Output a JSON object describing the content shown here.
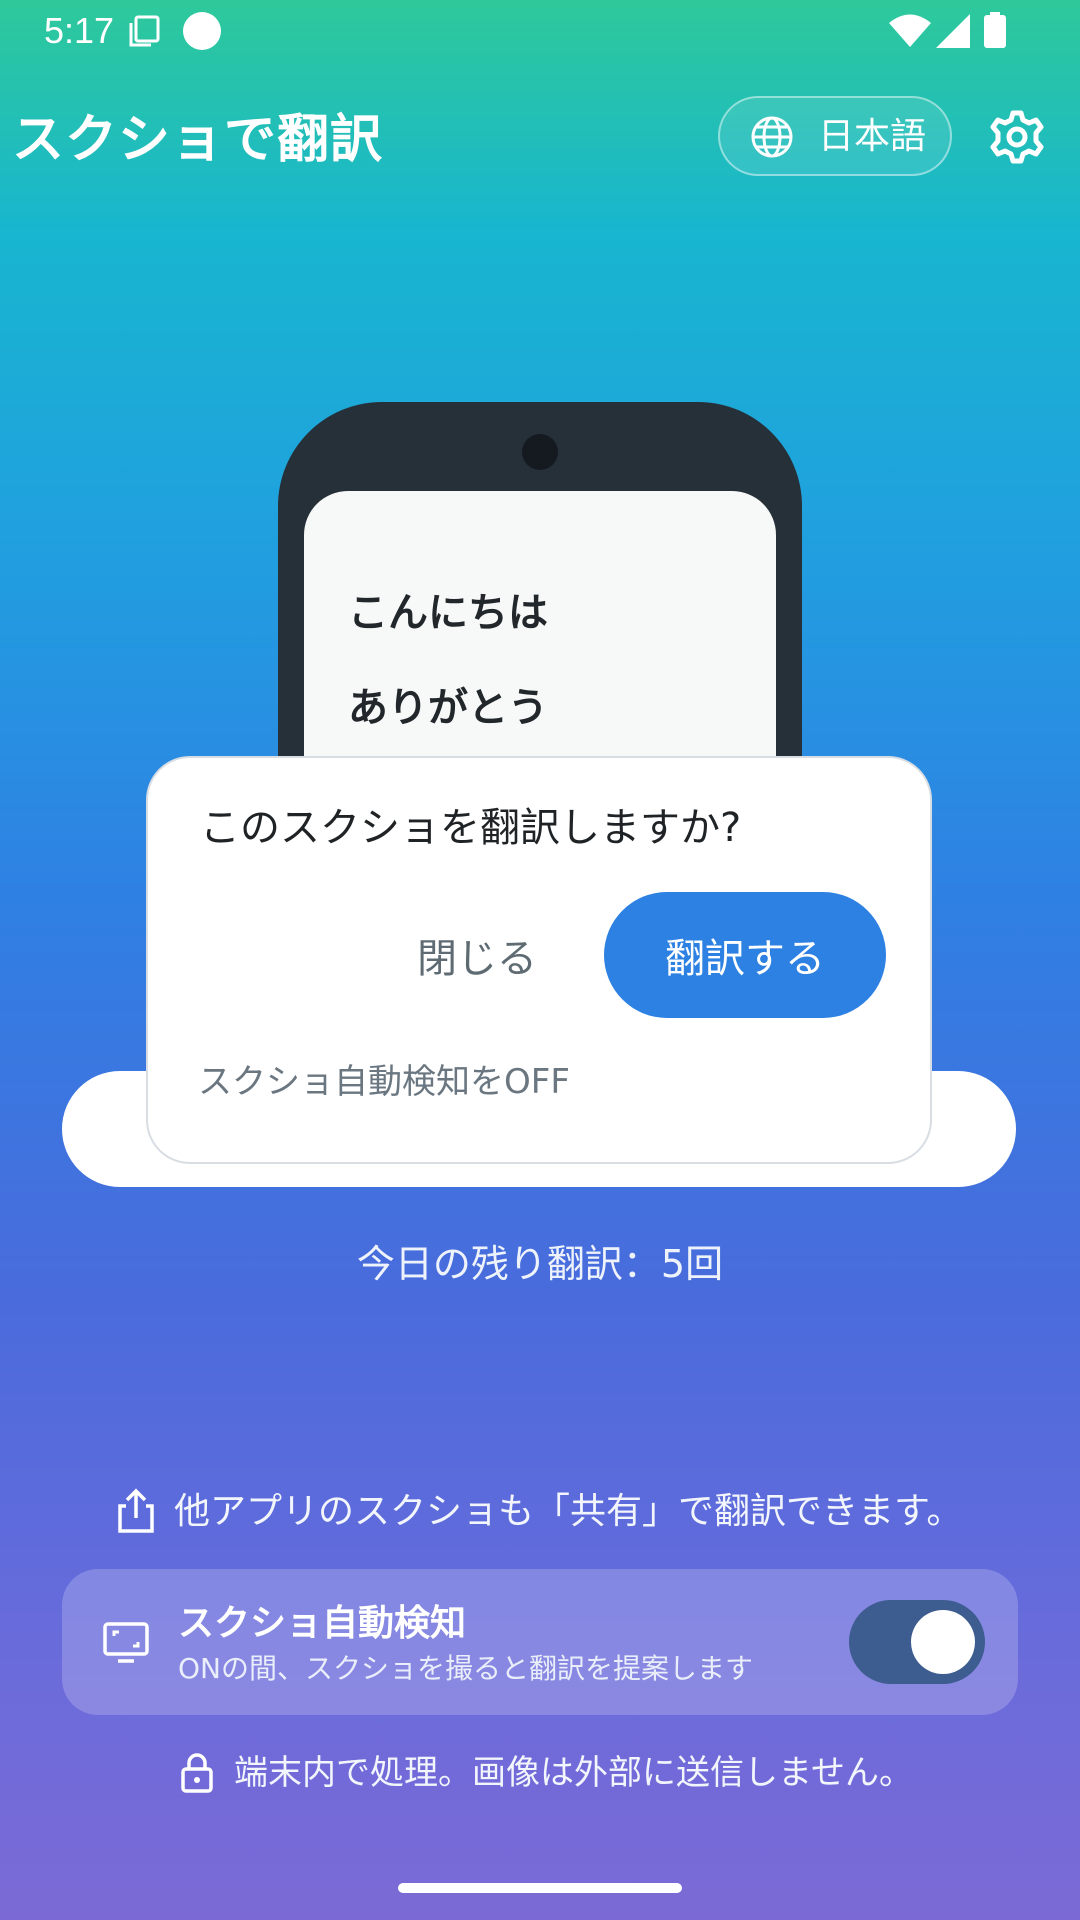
{
  "status_bar": {
    "time": "5:17",
    "icons": [
      "screenshot-icon",
      "dot-icon",
      "wifi-icon",
      "signal-icon",
      "battery-icon"
    ]
  },
  "header": {
    "title": "スクショで翻訳",
    "language_label": "日本語",
    "icons": [
      "globe-icon",
      "gear-icon"
    ]
  },
  "illustration": {
    "line1": "こんにちは",
    "line2": "ありがとう"
  },
  "dialog": {
    "question": "このスクショを翻訳しますか?",
    "close_label": "閉じる",
    "translate_label": "翻訳する",
    "auto_detect_off_label": "スクショ自動検知をOFF"
  },
  "remaining": "今日の残り翻訳：5回",
  "share_hint": "他アプリのスクショも「共有」で翻訳できます。",
  "auto_detect": {
    "title": "スクショ自動検知",
    "description": "ONの間、スクショを撮ると翻訳を提案します",
    "enabled": true
  },
  "privacy": "端末内で処理。画像は外部に送信しません。",
  "colors": {
    "accent": "#2c81e3",
    "toggle_track": "#3d5c8f",
    "phone_body": "#263039"
  }
}
